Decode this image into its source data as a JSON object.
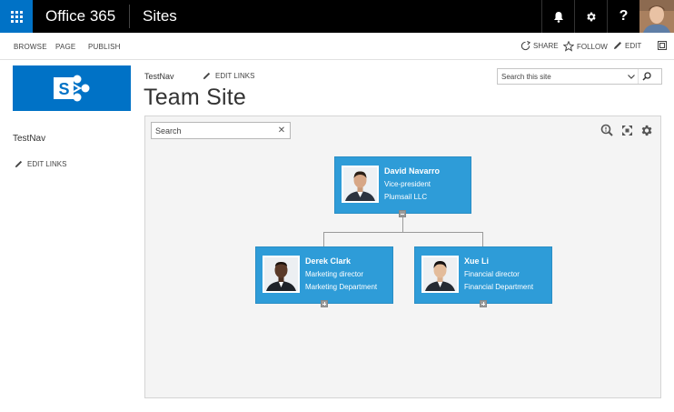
{
  "suite": {
    "brand": "Office 365",
    "app": "Sites"
  },
  "ribbon": {
    "tabs": [
      "BROWSE",
      "PAGE",
      "PUBLISH"
    ],
    "share": "SHARE",
    "follow": "FOLLOW",
    "edit": "EDIT"
  },
  "nav": {
    "top_item": "TestNav",
    "top_edit": "EDIT LINKS",
    "side_item": "TestNav",
    "side_edit": "EDIT LINKS"
  },
  "site": {
    "title": "Team Site",
    "search_placeholder": "Search this site"
  },
  "orgchart": {
    "search_placeholder": "Search",
    "root": {
      "name": "David Navarro",
      "title": "Vice-president",
      "department": "Plumsail LLC"
    },
    "children": [
      {
        "name": "Derek Clark",
        "title": "Marketing director",
        "department": "Marketing Department"
      },
      {
        "name": "Xue Li",
        "title": "Financial director",
        "department": "Financial Department"
      }
    ]
  },
  "colors": {
    "suite_bar": "#000000",
    "waffle": "#0072c6",
    "card": "#2e9cd8",
    "panel": "#f4f4f4"
  }
}
